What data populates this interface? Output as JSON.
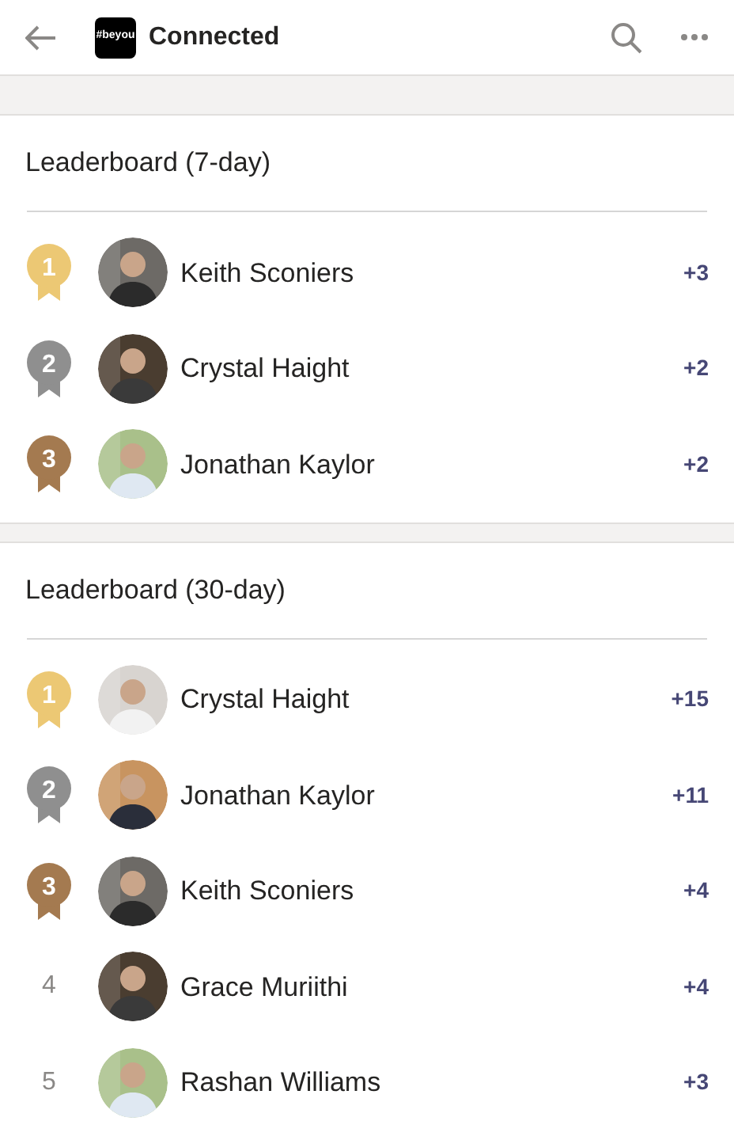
{
  "header": {
    "logo_text": "#beyou",
    "title": "Connected"
  },
  "leaderboards": [
    {
      "title": "Leaderboard (7-day)",
      "rows": [
        {
          "rank": "1",
          "kind": "medal",
          "color": "#ecc874",
          "name": "Keith Sconiers",
          "score": "+3"
        },
        {
          "rank": "2",
          "kind": "medal",
          "color": "#8f8f8f",
          "name": "Crystal Haight",
          "score": "+2"
        },
        {
          "rank": "3",
          "kind": "medal",
          "color": "#a47a50",
          "name": "Jonathan Kaylor",
          "score": "+2"
        }
      ]
    },
    {
      "title": "Leaderboard (30-day)",
      "rows": [
        {
          "rank": "1",
          "kind": "medal",
          "color": "#ecc874",
          "name": "Crystal Haight",
          "score": "+15"
        },
        {
          "rank": "2",
          "kind": "medal",
          "color": "#8f8f8f",
          "name": "Jonathan Kaylor",
          "score": "+11"
        },
        {
          "rank": "3",
          "kind": "medal",
          "color": "#a47a50",
          "name": "Keith Sconiers",
          "score": "+4"
        },
        {
          "rank": "4",
          "kind": "plain",
          "name": "Grace Muriithi",
          "score": "+4"
        },
        {
          "rank": "5",
          "kind": "plain",
          "name": "Rashan Williams",
          "score": "+3"
        }
      ]
    }
  ]
}
